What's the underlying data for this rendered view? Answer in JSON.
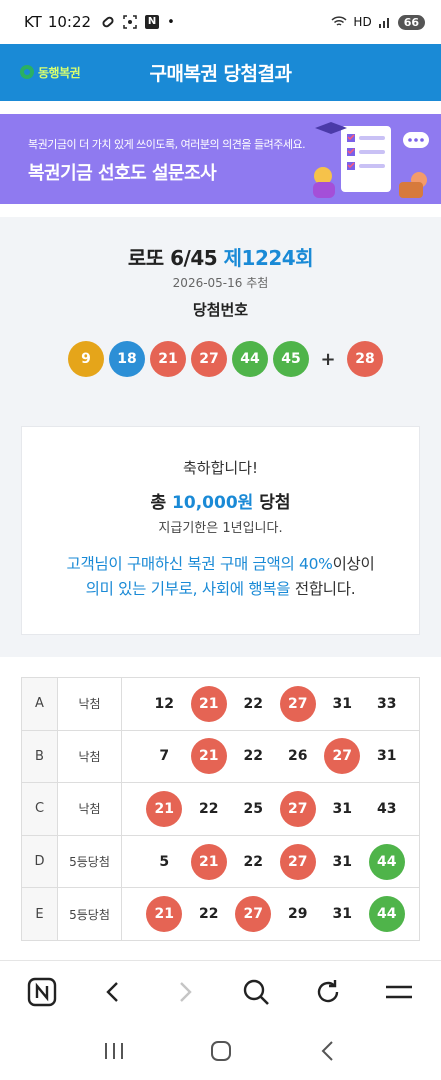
{
  "status_bar": {
    "carrier": "KT",
    "time": "10:22",
    "notif_badge": "N",
    "dot": "•",
    "network": "HD",
    "battery": "66"
  },
  "header": {
    "logo_text": "동행복권",
    "title": "구매복권 당첨결과",
    "brand_color": "#1a8ad6"
  },
  "banner": {
    "subtitle": "복권기금이 더 가치 있게 쓰이도록, 여러분의 의견을 들려주세요.",
    "title": "복권기금 선호도 설문조사",
    "bg_color": "#8f7af0"
  },
  "draw": {
    "game_name": "로또 6/45",
    "round": "제1224회",
    "date": "2026-05-16 추첨",
    "win_label": "당첨번호",
    "numbers": [
      {
        "n": "9",
        "color": "y"
      },
      {
        "n": "18",
        "color": "b"
      },
      {
        "n": "21",
        "color": "r"
      },
      {
        "n": "27",
        "color": "r"
      },
      {
        "n": "44",
        "color": "g"
      },
      {
        "n": "45",
        "color": "g"
      }
    ],
    "plus": "+",
    "bonus": {
      "n": "28",
      "color": "r"
    }
  },
  "congrats": {
    "heading": "축하합니다!",
    "total_prefix": "총",
    "total_amount": "10,000원",
    "total_suffix": "당첨",
    "deadline": "지급기한은 1년입니다.",
    "msg_parts": [
      {
        "t": "고객님이 구매하신 복권 구매 금액의 40%",
        "hl": true
      },
      {
        "t": "이상이",
        "hl": false
      },
      {
        "t": "의미 있는 기부로, 사회에 행복을",
        "hl": true
      },
      {
        "t": " 전합니다.",
        "hl": false
      }
    ]
  },
  "games": [
    {
      "slot": "A",
      "result": "낙첨",
      "nums": [
        {
          "n": "12",
          "c": ""
        },
        {
          "n": "21",
          "c": "r"
        },
        {
          "n": "22",
          "c": ""
        },
        {
          "n": "27",
          "c": "r"
        },
        {
          "n": "31",
          "c": ""
        },
        {
          "n": "33",
          "c": ""
        }
      ]
    },
    {
      "slot": "B",
      "result": "낙첨",
      "nums": [
        {
          "n": "7",
          "c": ""
        },
        {
          "n": "21",
          "c": "r"
        },
        {
          "n": "22",
          "c": ""
        },
        {
          "n": "26",
          "c": ""
        },
        {
          "n": "27",
          "c": "r"
        },
        {
          "n": "31",
          "c": ""
        }
      ]
    },
    {
      "slot": "C",
      "result": "낙첨",
      "nums": [
        {
          "n": "21",
          "c": "r"
        },
        {
          "n": "22",
          "c": ""
        },
        {
          "n": "25",
          "c": ""
        },
        {
          "n": "27",
          "c": "r"
        },
        {
          "n": "31",
          "c": ""
        },
        {
          "n": "43",
          "c": ""
        }
      ]
    },
    {
      "slot": "D",
      "result": "5등당첨",
      "nums": [
        {
          "n": "5",
          "c": ""
        },
        {
          "n": "21",
          "c": "r"
        },
        {
          "n": "22",
          "c": ""
        },
        {
          "n": "27",
          "c": "r"
        },
        {
          "n": "31",
          "c": ""
        },
        {
          "n": "44",
          "c": "g"
        }
      ]
    },
    {
      "slot": "E",
      "result": "5등당첨",
      "nums": [
        {
          "n": "21",
          "c": "r"
        },
        {
          "n": "22",
          "c": ""
        },
        {
          "n": "27",
          "c": "r"
        },
        {
          "n": "29",
          "c": ""
        },
        {
          "n": "31",
          "c": ""
        },
        {
          "n": "44",
          "c": "g"
        }
      ]
    }
  ],
  "browser_toolbar": {
    "icons": [
      "naver-home-icon",
      "back-icon",
      "forward-icon",
      "search-icon",
      "refresh-icon",
      "menu-icon"
    ]
  },
  "system_nav": {
    "icons": [
      "recent-apps-icon",
      "home-icon",
      "back-icon"
    ]
  }
}
